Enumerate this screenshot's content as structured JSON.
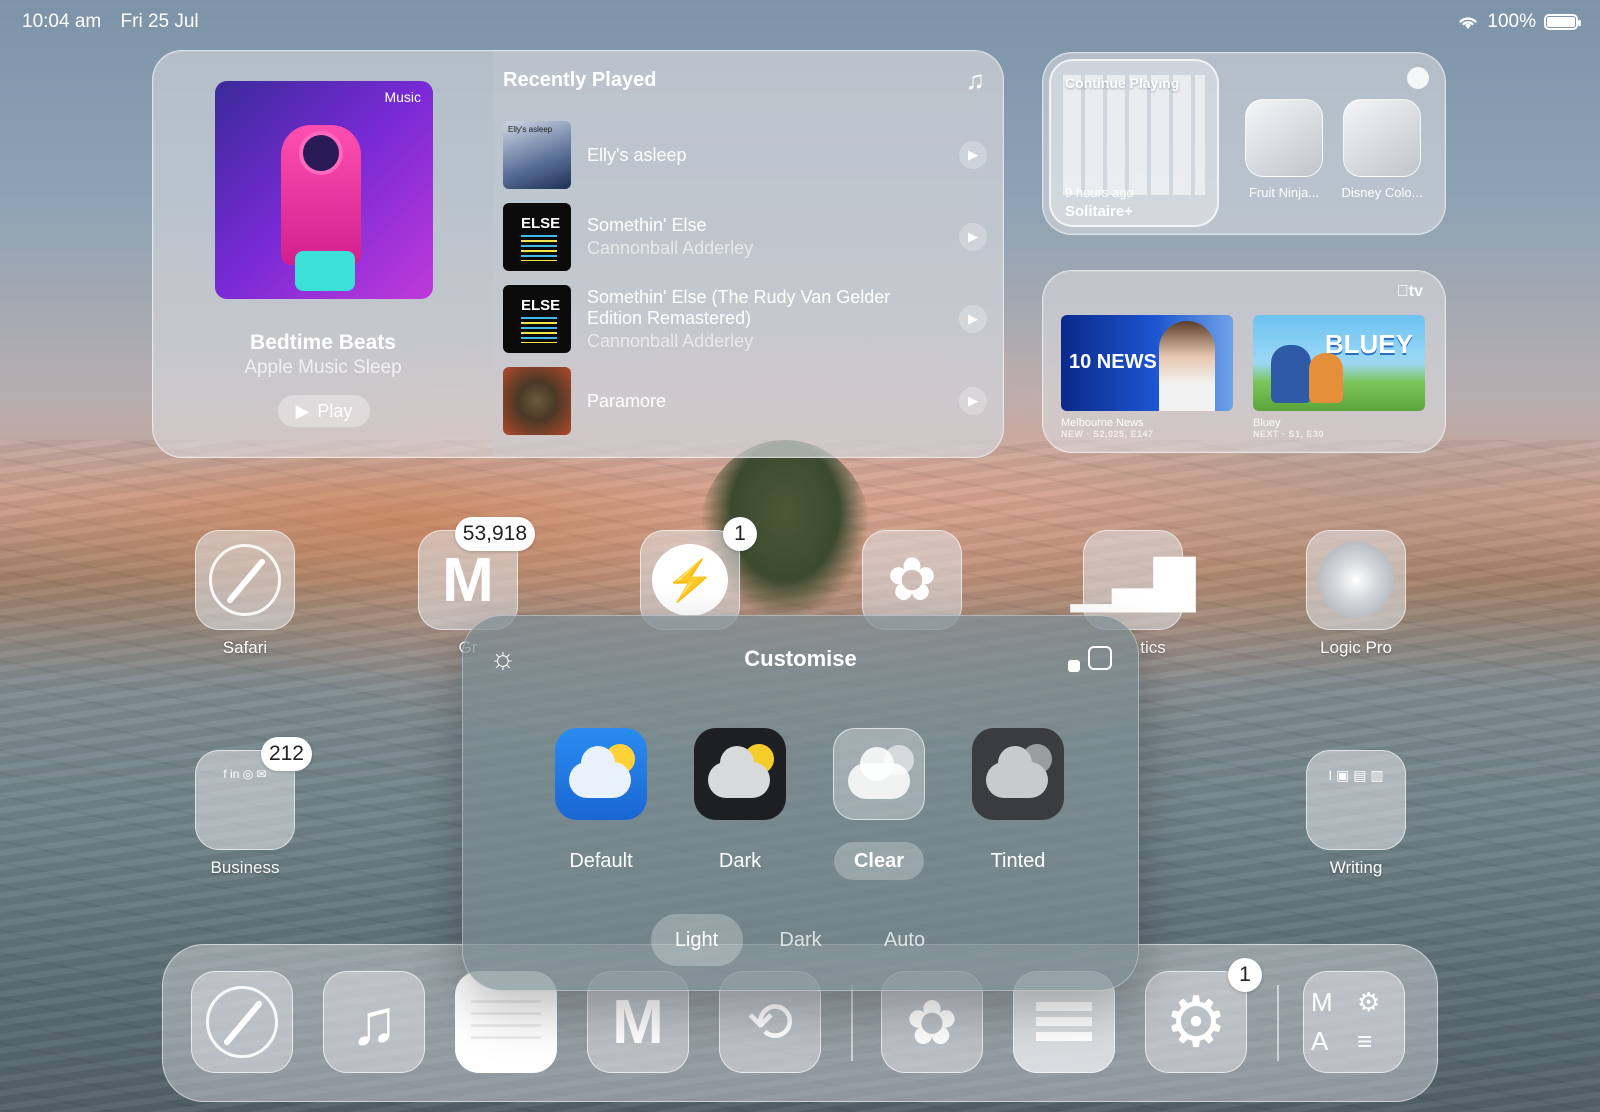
{
  "status_bar": {
    "time": "10:04 am",
    "date": "Fri 25 Jul",
    "battery": "100%"
  },
  "music_widget": {
    "album_logo": "Music",
    "playlist_title": "Bedtime Beats",
    "playlist_subtitle": "Apple Music Sleep",
    "play_label": "Play",
    "section_title": "Recently Played",
    "tracks": [
      {
        "name": "Elly's asleep",
        "artist": "",
        "art_caption": "Elly's asleep"
      },
      {
        "name": "Somethin' Else",
        "artist": "Cannonball Adderley",
        "art_caption": "ELSE"
      },
      {
        "name": "Somethin' Else (The Rudy Van Gelder Edition Remastered)",
        "artist": "Cannonball Adderley",
        "art_caption": "ELSE"
      },
      {
        "name": "Paramore",
        "artist": "",
        "art_caption": ""
      }
    ]
  },
  "games_widget": {
    "continue_label": "Continue Playing",
    "last_played": "9 hours ago",
    "game_name": "Solitaire+",
    "apps": [
      {
        "label": "Fruit Ninja..."
      },
      {
        "label": "Disney Colo..."
      }
    ]
  },
  "tv_widget": {
    "logo": "tv",
    "items": [
      {
        "title": "Melbourne News",
        "subtitle": "NEW · S2,025, E147",
        "thumb_text": "10 NEWS"
      },
      {
        "title": "Bluey",
        "subtitle": "NEXT · S1, E30",
        "thumb_text": "BLUEY"
      }
    ]
  },
  "home_apps": [
    {
      "label": "Safari",
      "badge": ""
    },
    {
      "label": "Gr",
      "badge": "53,918"
    },
    {
      "label": "",
      "badge": "1"
    },
    {
      "label": "",
      "badge": ""
    },
    {
      "label": "tics",
      "badge": ""
    },
    {
      "label": "Logic Pro",
      "badge": ""
    },
    {
      "label": "Business",
      "badge": "212"
    },
    {
      "label": "Writing",
      "badge": ""
    }
  ],
  "dock": {
    "badge_settings": "1"
  },
  "customise_panel": {
    "title": "Customise",
    "options": [
      {
        "label": "Default",
        "selected": false
      },
      {
        "label": "Dark",
        "selected": false
      },
      {
        "label": "Clear",
        "selected": true
      },
      {
        "label": "Tinted",
        "selected": false
      }
    ],
    "modes": [
      {
        "label": "Light",
        "selected": true
      },
      {
        "label": "Dark",
        "selected": false
      },
      {
        "label": "Auto",
        "selected": false
      }
    ]
  }
}
